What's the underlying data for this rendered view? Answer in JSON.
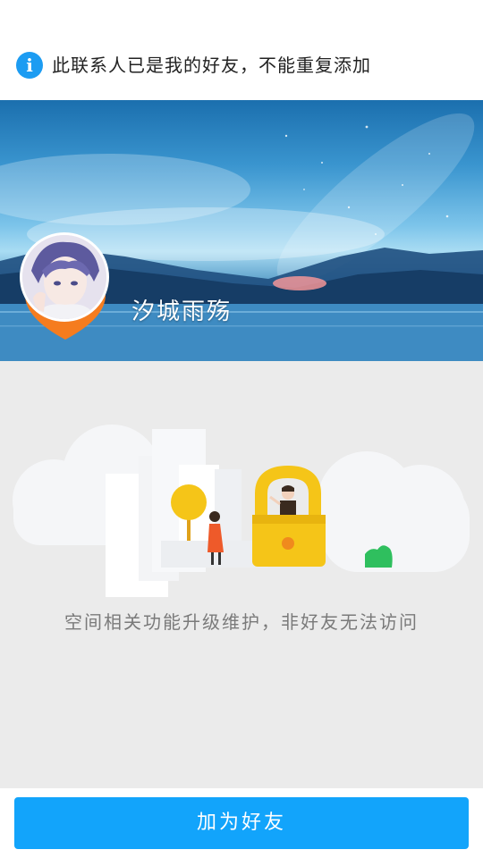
{
  "notice": {
    "icon": "info-icon",
    "icon_glyph": "i",
    "text": "此联系人已是我的好友，不能重复添加"
  },
  "profile": {
    "nickname": "汐城雨殇",
    "avatar": "anime-avatar",
    "badge_color": "#f57c1f"
  },
  "space": {
    "illustration": "locked-space-illustration",
    "message": "空间相关功能升级维护，非好友无法访问"
  },
  "actions": {
    "add_friend_label": "加为好友",
    "button_color": "#12a4fb"
  }
}
